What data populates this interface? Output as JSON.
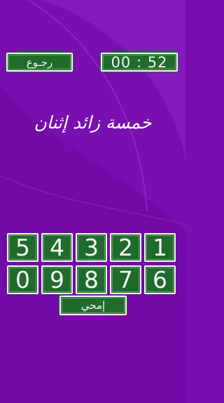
{
  "colors": {
    "background": "#7a0fb0",
    "chalkboard": "#1f6b2c",
    "chalk": "#f4f4f4"
  },
  "header": {
    "back_label": "رجـوع",
    "timer": "00 : 52"
  },
  "question": "خمسة زائد إثنان",
  "keypad": {
    "row1": [
      "5",
      "4",
      "3",
      "2",
      "1"
    ],
    "row2": [
      "0",
      "9",
      "8",
      "7",
      "6"
    ],
    "clear_label": "إمحي"
  }
}
